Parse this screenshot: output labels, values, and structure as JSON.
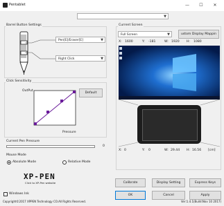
{
  "window": {
    "title": "Pentablet",
    "minimize": "—",
    "maximize": "☐",
    "close": "✕"
  },
  "top_combo": {
    "value": ""
  },
  "barrel": {
    "label": "Barrel Button Settings",
    "button1": "Pen[E]/Eraser[E]",
    "button2": "Right Click"
  },
  "sensitivity": {
    "label": "Click Sensitivity",
    "output_label": "OutPut",
    "pressure_label": "Pressure",
    "default_button": "Default"
  },
  "pen_pressure": {
    "label": "Current Pen Pressure",
    "value": "0"
  },
  "mouse_mode": {
    "label": "Mouse Mode",
    "absolute": "Absolute Mode",
    "relative": "Relative Mode",
    "selected": "absolute"
  },
  "logo": {
    "brand": "XP-PEN",
    "link": "Click to XP-Pen website"
  },
  "windows_ink": "Windows Ink",
  "copyright": "Copyright©2017 XPPEN Technology CO.All Rights Reserved.",
  "version": "Ver:1.4.1(Build:Nov 10 2017)",
  "screen": {
    "label": "Current Screen",
    "mode": "Full Screen",
    "custom_button": "ustom Display Mappin",
    "x_label": "X:",
    "x_value": "1600",
    "y_label": "Y:",
    "y_value": "-181",
    "w_label": "W:",
    "w_value": "1920",
    "h_label": "H:",
    "h_value": "1080"
  },
  "tablet": {
    "x_label": "X:",
    "x_value": "0",
    "y_label": "Y:",
    "y_value": "0",
    "w_label": "W:",
    "w_value": "29.44",
    "h_label": "H:",
    "h_value": "16.56",
    "unit": "[cm]"
  },
  "buttons": {
    "calibrate": "Calibrate",
    "display_setting": "Display Setting",
    "express_keys": "Express Keys",
    "ok": "OK",
    "cancel": "Cancel",
    "apply": "Apply"
  },
  "colors": {
    "accent": "#0078d7",
    "curve": "#6a1b9a",
    "desktop": "#0a3d91"
  }
}
